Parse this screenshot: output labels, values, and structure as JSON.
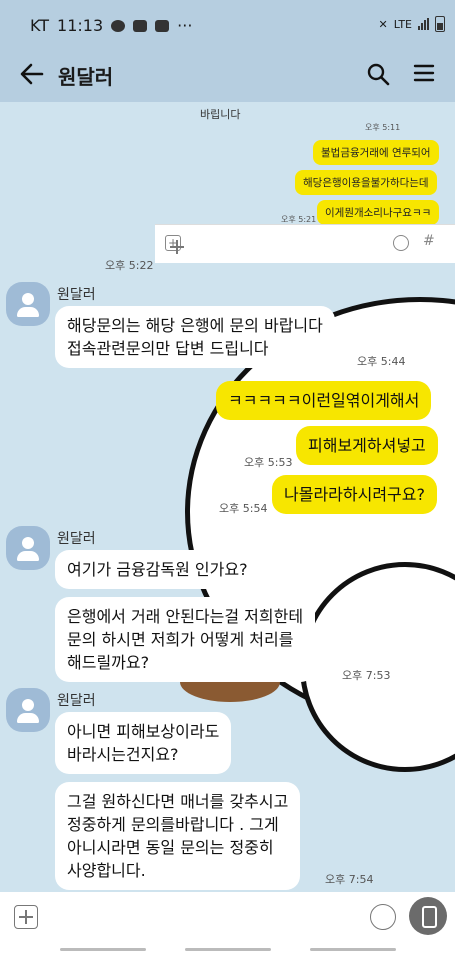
{
  "status": {
    "carrier": "KT",
    "time": "11:13",
    "dots": "···",
    "net": "LTE"
  },
  "header": {
    "title": "원달러"
  },
  "embedded": {
    "top_text": "바립니다",
    "top_time": "오후 5:11",
    "msgs": [
      "불법금융거래에 연루되어",
      "해당은행이용을불가하다는데",
      "이게뭔개소리나구요ㅋㅋ"
    ],
    "time": "오후 5:21",
    "plus": "+",
    "hash": "#"
  },
  "messages": {
    "shot_time": "오후 5:22",
    "sender": "원달러",
    "m1": "해당문의는 해당 은행에 문의 바랍니다\n접속관련문의만 답변 드립니다",
    "t1": "오후 5:44",
    "me1": "ㅋㅋㅋㅋㅋ이런일엮이게해서",
    "me2": "피해보게하셔넣고",
    "t2": "오후 5:53",
    "me3": "나몰라라하시려구요?",
    "t3": "오후 5:54",
    "m2": "여기가 금융감독원 인가요?",
    "m3": "은행에서 거래 안된다는걸 저희한테\n문의 하시면 저희가 어떻게 처리를\n해드릴까요?",
    "t4": "오후 7:53",
    "m4": "아니면 피해보상이라도\n바라시는건지요?",
    "m5": "그걸 원하신다면 매너를 갖추시고\n정중하게 문의를바랍니다 . 그게\n아니시라면 동일 문의는 정중히\n사양합니다.",
    "t5": "오후 7:54"
  }
}
